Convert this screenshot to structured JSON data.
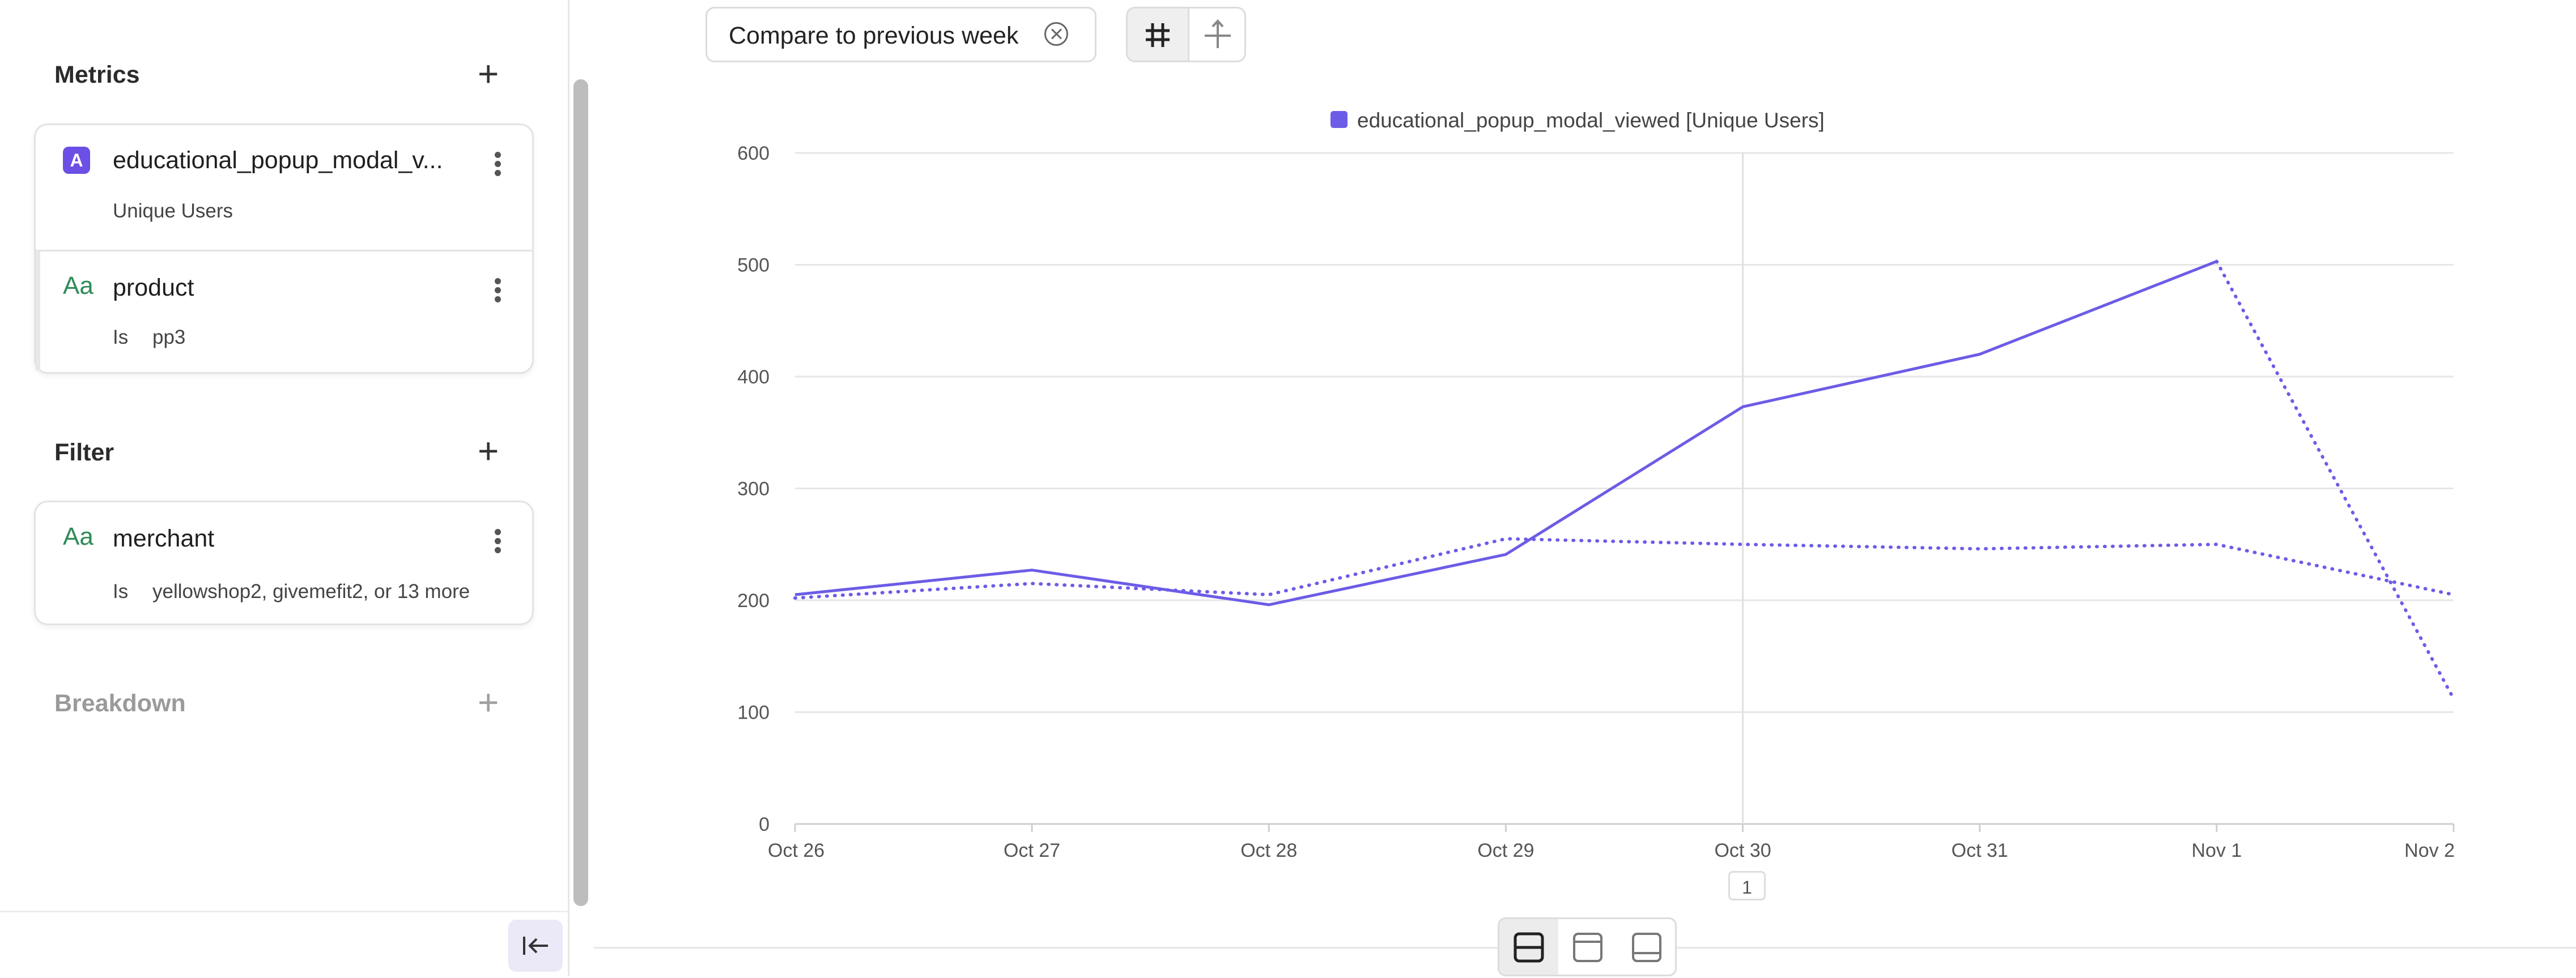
{
  "sidebar": {
    "metrics": {
      "heading": "Metrics",
      "items": [
        {
          "badge": "A",
          "title": "educational_popup_modal_v...",
          "subtitle": "Unique Users"
        },
        {
          "badge": "Aa",
          "title": "product",
          "op": "Is",
          "value": "pp3"
        }
      ]
    },
    "filter": {
      "heading": "Filter",
      "items": [
        {
          "badge": "Aa",
          "title": "merchant",
          "op": "Is",
          "value": "yellowshop2, givemefit2, or 13 more"
        }
      ]
    },
    "breakdown": {
      "heading": "Breakdown"
    }
  },
  "toolbar": {
    "compare_label": "Compare to previous week"
  },
  "chart_data": {
    "type": "line",
    "categories": [
      "Oct 26",
      "Oct 27",
      "Oct 28",
      "Oct 29",
      "Oct 30",
      "Oct 31",
      "Nov 1",
      "Nov 2"
    ],
    "ylim": [
      0,
      600
    ],
    "yticks": [
      0,
      100,
      200,
      300,
      400,
      500,
      600
    ],
    "legend": [
      "educational_popup_modal_viewed [Unique Users]"
    ],
    "legend_position": "top-center",
    "series": [
      {
        "name": "educational_popup_modal_viewed [Unique Users]",
        "style": "solid",
        "color": "#6c5ce7",
        "values": [
          205,
          227,
          196,
          241,
          373,
          420,
          503,
          null
        ]
      },
      {
        "style": "dotted",
        "color": "#6c5ce7",
        "values": [
          202,
          215,
          205,
          255,
          250,
          246,
          250,
          205
        ]
      },
      {
        "style": "dotted",
        "color": "#6c5ce7",
        "values": [
          null,
          null,
          null,
          null,
          null,
          null,
          503,
          112
        ]
      }
    ],
    "grid": true,
    "hover_index": 4
  },
  "pagination": {
    "page": "1"
  }
}
